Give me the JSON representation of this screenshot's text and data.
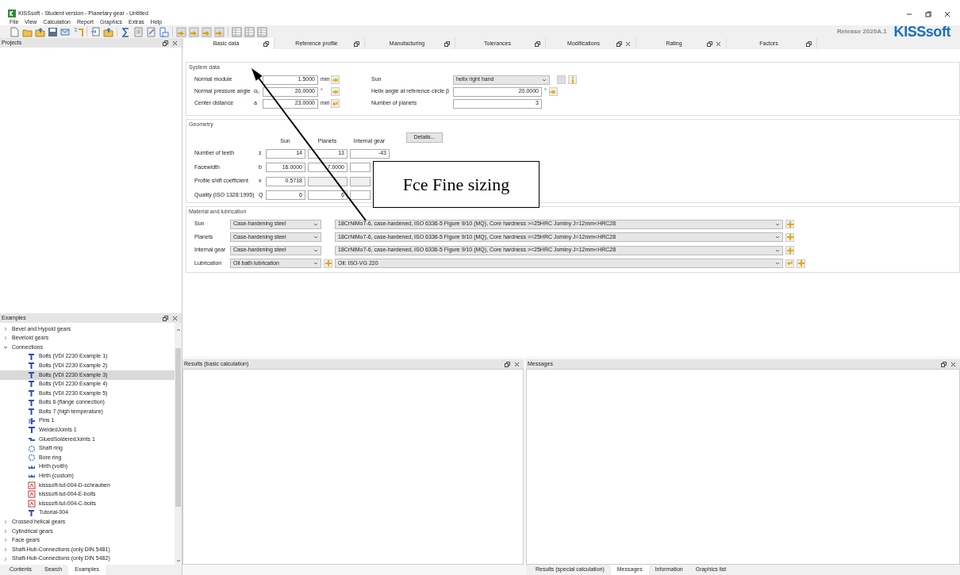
{
  "window": {
    "title": "KISSsoft - Student version - Planetary gear - Untitled"
  },
  "menu": [
    "File",
    "View",
    "Calculation",
    "Report",
    "Graphics",
    "Extras",
    "Help"
  ],
  "release": "Release 2020A.1",
  "logo": "KISSsoft",
  "projects_panel": {
    "title": "Projects"
  },
  "examples_panel": {
    "title": "Examples",
    "tree": [
      {
        "label": "Bevel and Hypoid gears",
        "expanded": false,
        "selected": false
      },
      {
        "label": "Beveloid gears",
        "expanded": false,
        "selected": false
      },
      {
        "label": "Connections",
        "expanded": true,
        "selected": false,
        "children": [
          {
            "label": "Bolts (VDI 2230 Example 1)",
            "kind": "bolt",
            "selected": false
          },
          {
            "label": "Bolts (VDI 2230 Example 2)",
            "kind": "bolt",
            "selected": false
          },
          {
            "label": "Bolts (VDI 2230 Example 3)",
            "kind": "bolt",
            "selected": true
          },
          {
            "label": "Bolts (VDI 2230 Example 4)",
            "kind": "bolt",
            "selected": false
          },
          {
            "label": "Bolts (VDI 2230 Example 5)",
            "kind": "bolt",
            "selected": false
          },
          {
            "label": "Bolts 6 (flange connection)",
            "kind": "bolt",
            "selected": false
          },
          {
            "label": "Bolts 7 (high temperature)",
            "kind": "bolt",
            "selected": false
          },
          {
            "label": "Pins 1",
            "kind": "pin",
            "selected": false
          },
          {
            "label": "WeldedJoints 1",
            "kind": "weld",
            "selected": false
          },
          {
            "label": "GluedSolderedJoints 1",
            "kind": "glue",
            "selected": false
          },
          {
            "label": "Shaft ring",
            "kind": "ring",
            "selected": false
          },
          {
            "label": "Bore ring",
            "kind": "ring",
            "selected": false
          },
          {
            "label": "Hirth (voith)",
            "kind": "hirth",
            "selected": false
          },
          {
            "label": "Hirth (custom)",
            "kind": "hirth",
            "selected": false
          },
          {
            "label": "kisssoft-tut-004-D-schrauben",
            "kind": "pdf",
            "selected": false
          },
          {
            "label": "kisssoft-tut-004-E-bolts",
            "kind": "pdf",
            "selected": false
          },
          {
            "label": "kisssoft-tut-004-C-bolts",
            "kind": "pdf",
            "selected": false
          },
          {
            "label": "Tutorial-004",
            "kind": "bolt",
            "selected": false
          }
        ]
      },
      {
        "label": "Crossed helical gears",
        "expanded": false,
        "selected": false
      },
      {
        "label": "Cylindrical gears",
        "expanded": false,
        "selected": false
      },
      {
        "label": "Face gears",
        "expanded": false,
        "selected": false
      },
      {
        "label": "Shaft-Hub-Connections (only DIN 5481)",
        "expanded": false,
        "selected": false
      },
      {
        "label": "Shaft-Hub-Connections (only DIN 5482)",
        "expanded": false,
        "selected": false
      }
    ]
  },
  "left_tabs": [
    {
      "label": "Contents",
      "selected": false
    },
    {
      "label": "Search",
      "selected": false
    },
    {
      "label": "Examples",
      "selected": true
    }
  ],
  "tabs": [
    {
      "label": "Basic data",
      "selected": true,
      "closable": false
    },
    {
      "label": "Reference profile",
      "selected": false,
      "closable": false
    },
    {
      "label": "Manufacturing",
      "selected": false,
      "closable": false
    },
    {
      "label": "Tolerances",
      "selected": false,
      "closable": false
    },
    {
      "label": "Modifications",
      "selected": false,
      "closable": true
    },
    {
      "label": "Rating",
      "selected": false,
      "closable": true
    },
    {
      "label": "Factors",
      "selected": false,
      "closable": false
    }
  ],
  "system_data": {
    "title": "System data",
    "left_rows": [
      {
        "label": "Normal module",
        "value": "1.5000",
        "unit": "mm",
        "kind": "sizing"
      },
      {
        "label": "Normal pressure angle",
        "symbol": "αₙ",
        "value": "20.0000",
        "unit": "°",
        "kind": "sizing"
      },
      {
        "label": "Center distance",
        "symbol": "a",
        "value": "23.0000",
        "unit": "mm",
        "kind": "reverse"
      }
    ],
    "right_rows": [
      {
        "label": "Sun",
        "value": "helix right hand",
        "kind": "select"
      },
      {
        "label": "Helix angle at reference circle",
        "symbol": "β",
        "value": "20.0000",
        "unit": "°",
        "kind": "sizing"
      },
      {
        "label": "Number of planets",
        "value": "3",
        "kind": "plain"
      }
    ]
  },
  "geometry": {
    "title": "Geometry",
    "columns": [
      "Sun",
      "Planets",
      "Internal gear"
    ],
    "details_button": "Details...",
    "rows": [
      {
        "label": "Number of teeth",
        "symbol": "z",
        "cells": [
          {
            "value": "14",
            "disabled": false
          },
          {
            "value": "13",
            "disabled": false
          },
          {
            "value": "-43",
            "disabled": false
          }
        ]
      },
      {
        "label": "Facewidth",
        "symbol": "b",
        "cells": [
          {
            "value": "16.0000",
            "disabled": false
          },
          {
            "value": "7.0000",
            "disabled": false
          },
          {
            "disabled": false
          }
        ]
      },
      {
        "label": "Profile shift coefficient",
        "symbol": "x",
        "cells": [
          {
            "value": "0.5718",
            "disabled": false
          },
          {
            "disabled": true
          },
          {
            "disabled": true
          }
        ]
      },
      {
        "label": "Quality (ISO 1328:1995)",
        "symbol": "Q",
        "cells": [
          {
            "value": "6",
            "disabled": false
          },
          {
            "value": "6",
            "disabled": false
          },
          {
            "disabled": false
          }
        ]
      }
    ]
  },
  "material": {
    "title": "Material and lubrication",
    "rows": [
      {
        "label": "Sun",
        "type": "Case-hardening steel",
        "material": "18CrNiMo7-6, case-hardened, ISO 6336-5 Figure 9/10 (MQ), Core hardness >=25HRC Jominy J=12mm<HRC28",
        "kind": "material"
      },
      {
        "label": "Planets",
        "type": "Case-hardening steel",
        "material": "18CrNiMo7-6, case-hardened, ISO 6336-5 Figure 9/10 (MQ), Core hardness >=25HRC Jominy J=12mm<HRC28",
        "kind": "material"
      },
      {
        "label": "Internal gear",
        "type": "Case-hardening steel",
        "material": "18CrNiMo7-6, case-hardened, ISO 6336-5 Figure 9/10 (MQ), Core hardness >=25HRC Jominy J=12mm<HRC28",
        "kind": "material"
      },
      {
        "label": "Lubrication",
        "type": "Oil bath lubrication",
        "material": "Oil: ISO-VG 220",
        "kind": "lubrication"
      }
    ]
  },
  "results_panel": {
    "title": "Results (basic calculation)"
  },
  "messages_panel": {
    "title": "Messages"
  },
  "bottom_tabs": [
    {
      "label": "Results (special calculation)",
      "selected": false
    },
    {
      "label": "Messages",
      "selected": true
    },
    {
      "label": "Information",
      "selected": false
    },
    {
      "label": "Graphics list",
      "selected": false
    }
  ],
  "annotation": {
    "text": "Fce Fine sizing"
  }
}
